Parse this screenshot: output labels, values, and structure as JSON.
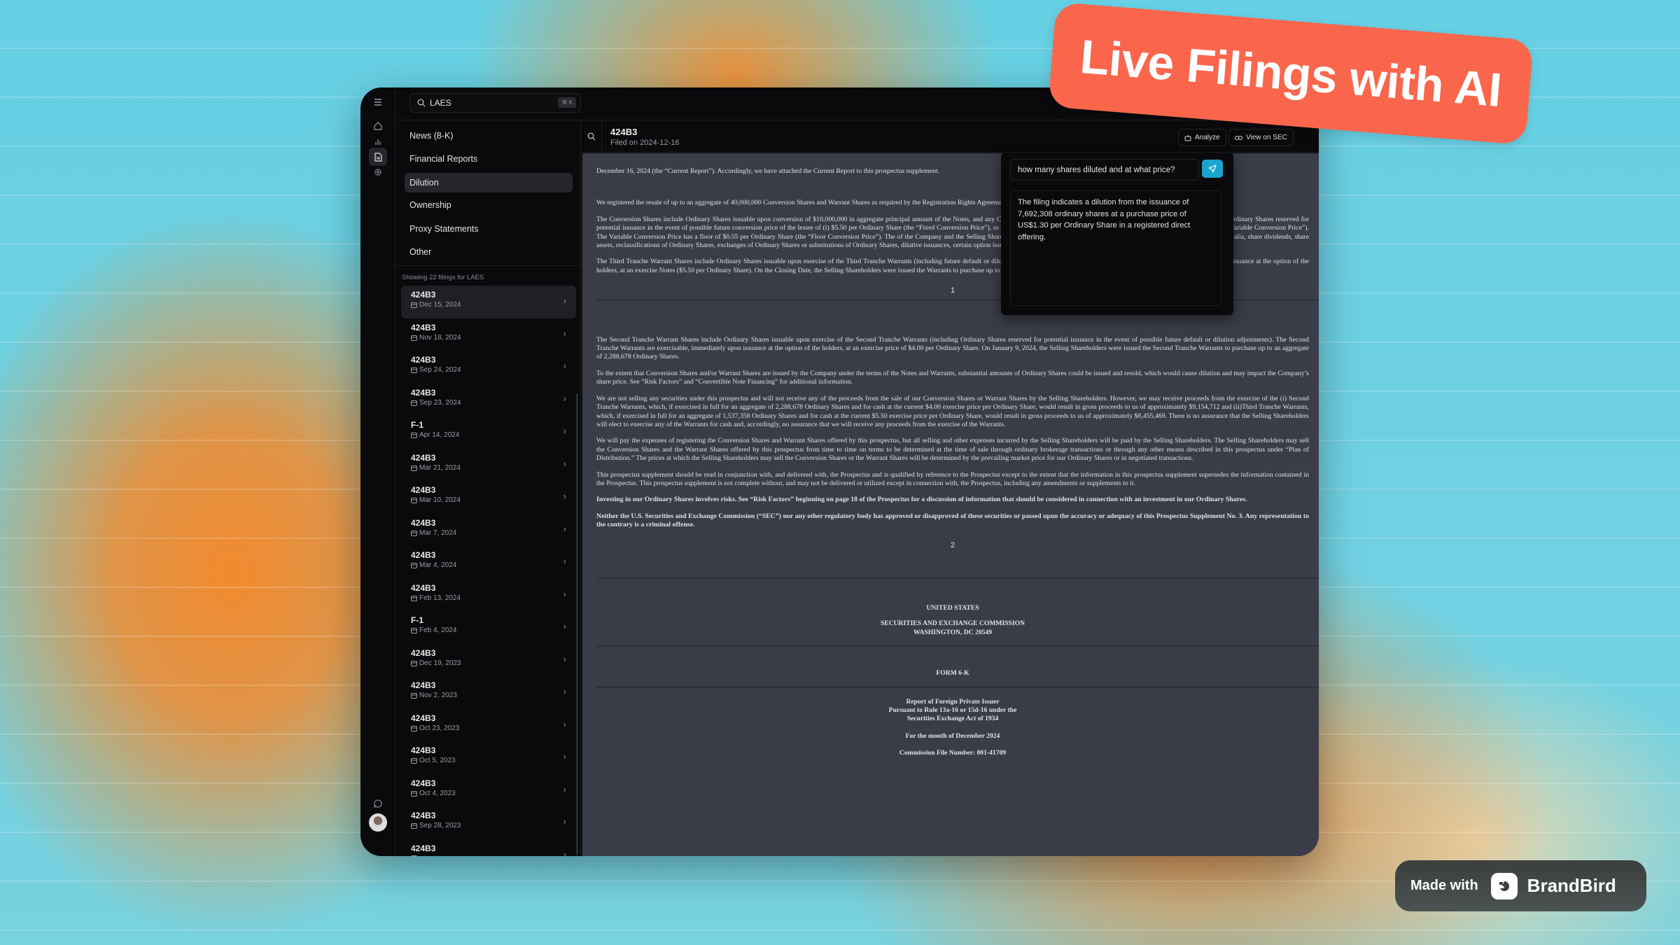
{
  "search": {
    "value": "LAES",
    "shortcut": "⌘ K"
  },
  "rail": {
    "icons": [
      "menu-icon",
      "home-icon",
      "chart-icon",
      "document-icon",
      "gear-icon",
      "chat-icon",
      "avatar"
    ]
  },
  "nav": {
    "items": [
      {
        "label": "News (8-K)"
      },
      {
        "label": "Financial Reports"
      },
      {
        "label": "Dilution",
        "active": true
      },
      {
        "label": "Ownership"
      },
      {
        "label": "Proxy Statements"
      },
      {
        "label": "Other"
      }
    ]
  },
  "filings": {
    "summary": "Showing 22 filings for LAES",
    "items": [
      {
        "type": "424B3",
        "date": "Dec 15, 2024"
      },
      {
        "type": "424B3",
        "date": "Nov 18, 2024"
      },
      {
        "type": "424B3",
        "date": "Sep 24, 2024"
      },
      {
        "type": "424B3",
        "date": "Sep 23, 2024"
      },
      {
        "type": "F-1",
        "date": "Apr 14, 2024"
      },
      {
        "type": "424B3",
        "date": "Mar 21, 2024"
      },
      {
        "type": "424B3",
        "date": "Mar 10, 2024"
      },
      {
        "type": "424B3",
        "date": "Mar 7, 2024"
      },
      {
        "type": "424B3",
        "date": "Mar 4, 2024"
      },
      {
        "type": "424B3",
        "date": "Feb 13, 2024"
      },
      {
        "type": "F-1",
        "date": "Feb 4, 2024"
      },
      {
        "type": "424B3",
        "date": "Dec 19, 2023"
      },
      {
        "type": "424B3",
        "date": "Nov 2, 2023"
      },
      {
        "type": "424B3",
        "date": "Oct 23, 2023"
      },
      {
        "type": "424B3",
        "date": "Oct 5, 2023"
      },
      {
        "type": "424B3",
        "date": "Oct 4, 2023"
      },
      {
        "type": "424B3",
        "date": "Sep 28, 2023"
      },
      {
        "type": "424B3",
        "date": ""
      }
    ]
  },
  "document": {
    "title": "424B3",
    "filed": "Filed on 2024-12-16",
    "analyze_label": "Analyze",
    "view_sec_label": "View on SEC",
    "paragraphs": [
      "December 16, 2024 (the “Current Report”). Accordingly, we have attached the Current Report to this prospectus supplement.",
      "We registered the resale of up to an aggregate of 40,000,000 Conversion Shares and Warrant Shares as required by the Registration Rights Agreement”), by and among us and the Selling Shareholders.",
      "The Conversion Shares include Ordinary Shares issuable upon conversion of $10,000,000 in aggregate principal amount of the Notes, and any Conversion Shares with the written consent of the Selling Shareholders (including Ordinary Shares reserved for potential issuance in the event of possible future conversion price of the lesser of (i) $5.50 per Ordinary Share (the “Fixed Conversion Price”), or (ii) 93% of the lowest daily variable-weighted average price (the conversion (the “Variable Conversion Price”). The Variable Conversion Price has a floor of $0.55 per Ordinary Share (the “Floor Conversion Price”). The of the Company and the Selling Shareholders. The Notes provide for adjustment of the Fixed Conversion Price for, inter alia, share dividends, share assets, reclassifications of Ordinary Shares, exchanges of Ordinary Shares or substitutions of Ordinary Shares, dilutive issuances, certain option issuances and Notes are convertible into an aggregate of 19,636,364 Ordinary Shares.",
      "The Third Tranche Warrant Shares include Ordinary Shares issuable upon exercise of the Third Tranche Warrants (including future default or dilution adjustments). The Third Tranche Warrants are exercisable, immediately upon issuance at the option of the holders, at an exercise Notes ($5.50 per Ordinary Share). On the Closing Date, the Selling Shareholders were issued the Warrants to purchase up to an aggregate of 1,537,358 Ordinary Shares."
    ],
    "page1": "1",
    "paragraphs2": [
      "The Second Tranche Warrant Shares include Ordinary Shares issuable upon exercise of the Second Tranche Warrants (including Ordinary Shares reserved for potential issuance in the event of possible future default or dilution adjustments). The Second Tranche Warrants are exercisable, immediately upon issuance at the option of the holders, at an exercise price of $4.00 per Ordinary Share. On January 9, 2024, the Selling Shareholders were issued the Second Tranche Warrants to purchase up to an aggregate of 2,288,678 Ordinary Shares.",
      "To the extent that Conversion Shares and/or Warrant Shares are issued by the Company under the terms of the Notes and Warrants, substantial amounts of Ordinary Shares could be issued and resold, which would cause dilution and may impact the Company’s share price. See “Risk Factors” and “Convertible Note Financing” for additional information.",
      "We are not selling any securities under this prospectus and will not receive any of the proceeds from the sale of our Conversion Shares or Warrant Shares by the Selling Shareholders. However, we may receive proceeds from the exercise of the (i) Second Tranche Warrants, which, if exercised in full for an aggregate of 2,288,678 Ordinary Shares and for cash at the current $4.00 exercise price per Ordinary Share, would result in gross proceeds to us of approximately $9,154,712 and (ii)Third Tranche Warrants, which, if exercised in full for an aggregate of 1,537,358 Ordinary Shares and for cash at the current $5.50 exercise price per Ordinary Share, would result in gross proceeds to us of approximately $8,455,469. There is no assurance that the Selling Shareholders will elect to exercise any of the Warrants for cash and, accordingly, no assurance that we will receive any proceeds from the exercise of the Warrants.",
      "We will pay the expenses of registering the Conversion Shares and Warrant Shares offered by this prospectus, but all selling and other expenses incurred by the Selling Shareholders will be paid by the Selling Shareholders. The Selling Shareholders may sell the Conversion Shares and the Warrant Shares offered by this prospectus from time to time on terms to be determined at the time of sale through ordinary brokerage transactions or through any other means described in this prospectus under “Plan of Distribution.” The prices at which the Selling Shareholders may sell the Conversion Shares or the Warrant Shares will be determined by the prevailing market price for our Ordinary Shares or in negotiated transactions.",
      "This prospectus supplement should be read in conjunction with, and delivered with, the Prospectus and is qualified by reference to the Prospectus except to the extent that the information in this prospectus supplement supersedes the information contained in the Prospectus. This prospectus supplement is not complete without, and may not be delivered or utilized except in connection with, the Prospectus, including any amendments or supplements to it."
    ],
    "bold_paragraphs": [
      "Investing in our Ordinary Shares involves risks. See “Risk Factors” beginning on page 18 of the Prospectus for a discussion of information that should be considered in connection with an investment in our Ordinary Shares.",
      "Neither the U.S. Securities and Exchange Commission (“SEC”) nor any other regulatory body has approved or disapproved of these securities or passed upon the accuracy or adequacy of this Prospectus Supplement No. 3. Any representation to the contrary is a criminal offense."
    ],
    "page2": "2",
    "cover": {
      "country": "UNITED STATES",
      "agency": "SECURITIES AND EXCHANGE COMMISSION",
      "address": "WASHINGTON, DC 20549",
      "form": "FORM 6-K",
      "report1": "Report of Foreign Private Issuer",
      "report2": "Pursuant to Rule 13a-16 or 15d-16 under the",
      "report3": "Securities Exchange Act of 1934",
      "month": "For the month of December 2024",
      "file": "Commission File Number: 001-41709"
    }
  },
  "ai": {
    "question": "how many shares diluted and at what price?",
    "answer": "The filing indicates a dilution from the issuance of 7,692,308 ordinary shares at a purchase price of US$1.30 per Ordinary Share in a registered direct offering.",
    "accent": "#1aa5cf"
  },
  "banner": {
    "text": "Live Filings with AI",
    "color": "#f9664c"
  },
  "badge": {
    "prefix": "Made with",
    "brand": "BrandBird"
  }
}
